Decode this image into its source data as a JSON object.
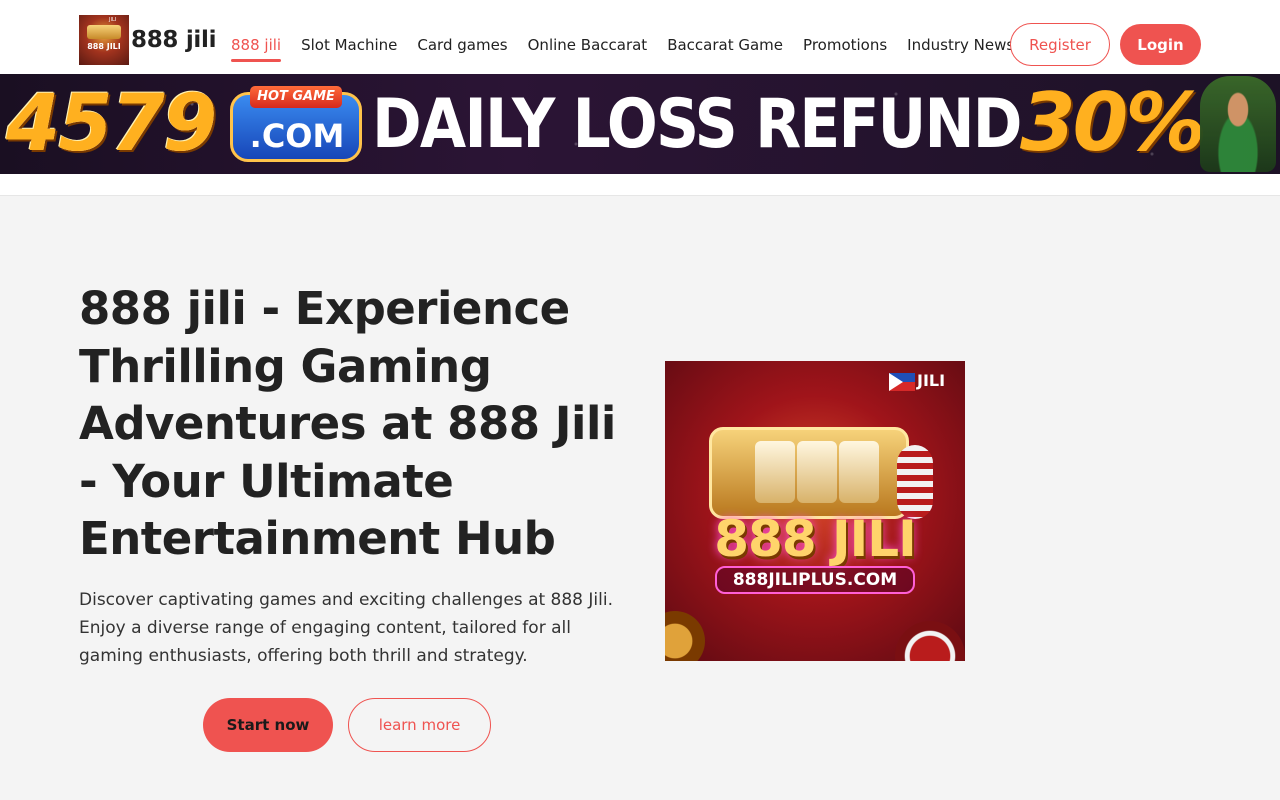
{
  "header": {
    "logo_image_text": "888 JILI",
    "logo_image_small_text": "JILI",
    "logo_text": "888 jili",
    "nav": [
      {
        "label": "888 jili",
        "active": true
      },
      {
        "label": "Slot Machine",
        "active": false
      },
      {
        "label": "Card games",
        "active": false
      },
      {
        "label": "Online Baccarat",
        "active": false
      },
      {
        "label": "Baccarat Game",
        "active": false
      },
      {
        "label": "Promotions",
        "active": false
      },
      {
        "label": "Industry News",
        "active": false
      }
    ],
    "register_label": "Register",
    "login_label": "Login"
  },
  "banner": {
    "number": "4579",
    "hot_game": "HOT GAME",
    "com": ".COM",
    "headline": "DAILY LOSS REFUND",
    "percent": "30%"
  },
  "hero": {
    "title": "888 jili - Experience Thrilling Gaming Adventures at 888 Jili - Your Ultimate Entertainment Hub",
    "description": "Discover captivating games and exciting challenges at 888 Jili. Enjoy a diverse range of engaging content, tailored for all gaming enthusiasts, offering both thrill and strategy.",
    "start_label": "Start now",
    "learn_label": "learn more",
    "image": {
      "brand": "JILI",
      "big_text": "888 JILI",
      "url": "888JILIPLUS.COM"
    }
  },
  "colors": {
    "accent": "#ef5350",
    "text": "#222222",
    "background": "#f4f4f4"
  }
}
